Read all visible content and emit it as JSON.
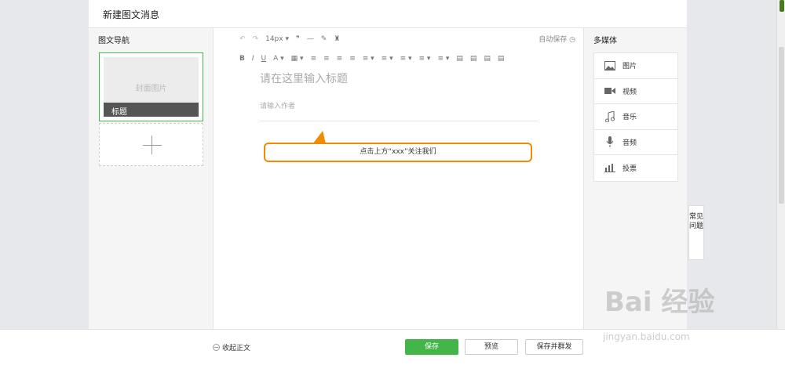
{
  "header": {
    "title": "新建图文消息"
  },
  "nav": {
    "title": "图文导航",
    "cover_placeholder": "封面图片",
    "cover_title": "标题"
  },
  "toolbar": {
    "row1": [
      "↶",
      "↷",
      "14px ▾",
      "❞",
      "—",
      "✎",
      "♜"
    ],
    "row2": [
      "B",
      "I",
      "U",
      "A ▾",
      "▦ ▾",
      "≡",
      "≡",
      "≡",
      "≡",
      "≡ ▾",
      "≡ ▾",
      "≡ ▾",
      "≡ ▾",
      "≡ ▾",
      "▤",
      "▤",
      "▤",
      "▤"
    ],
    "autosave": "自动保存"
  },
  "editor": {
    "title_placeholder": "请在这里输入标题",
    "author_placeholder": "请输入作者"
  },
  "tip": {
    "text": "点击上方“xxx”关注我们"
  },
  "media": {
    "title": "多媒体",
    "items": [
      {
        "label": "图片",
        "icon": "image-icon"
      },
      {
        "label": "视频",
        "icon": "video-icon"
      },
      {
        "label": "音乐",
        "icon": "music-icon"
      },
      {
        "label": "音频",
        "icon": "microphone-icon"
      },
      {
        "label": "投票",
        "icon": "poll-icon"
      }
    ]
  },
  "faq": {
    "label": "常见问题"
  },
  "footer": {
    "collapse_label": "收起正文",
    "save_label": "保存",
    "preview_label": "预览",
    "save_mass_label": "保存并群发"
  },
  "watermark": {
    "main": "Bai 经验",
    "sub": "jingyan.baidu.com"
  },
  "colors": {
    "accent": "#44b549",
    "tip_border": "#f08c00"
  }
}
